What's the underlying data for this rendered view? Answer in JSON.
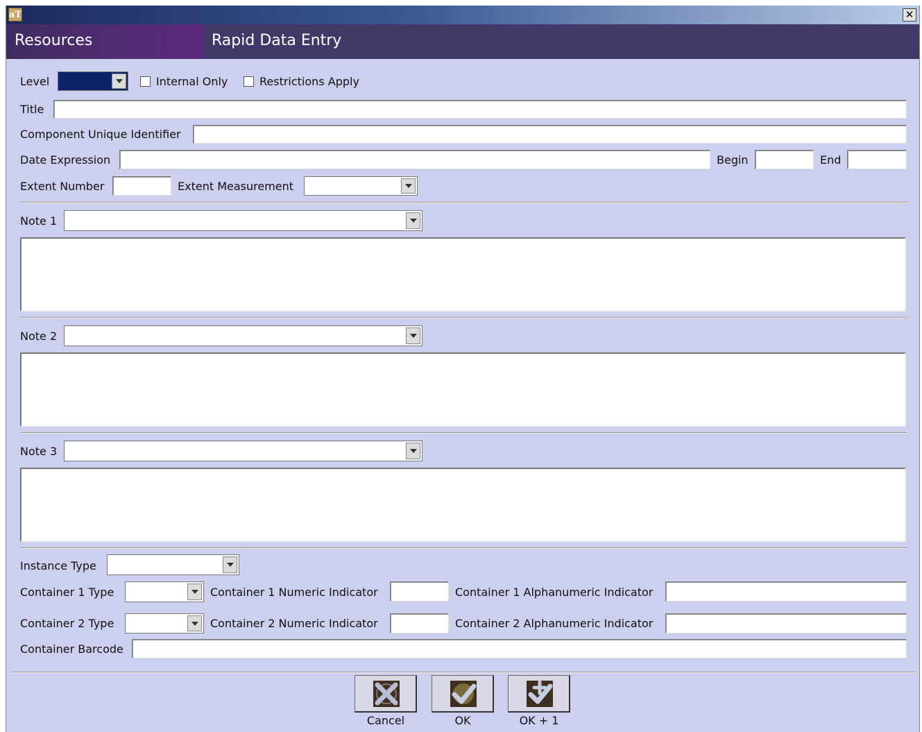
{
  "header": {
    "left_title": "Resources",
    "right_title": "Rapid Data Entry"
  },
  "window": {
    "close_glyph": "✕",
    "app_icon_text": "aT"
  },
  "top_row": {
    "level_label": "Level",
    "level_value": "",
    "internal_only_label": "Internal Only",
    "internal_only_checked": false,
    "restrictions_label": "Restrictions Apply",
    "restrictions_checked": false
  },
  "fields": {
    "title_label": "Title",
    "title_value": "",
    "cuid_label": "Component Unique Identifier",
    "cuid_value": "",
    "date_expr_label": "Date Expression",
    "date_expr_value": "",
    "begin_label": "Begin",
    "begin_value": "",
    "end_label": "End",
    "end_value": "",
    "extent_number_label": "Extent Number",
    "extent_number_value": "",
    "extent_measurement_label": "Extent Measurement",
    "extent_measurement_value": ""
  },
  "notes": [
    {
      "label": "Note 1",
      "type": "",
      "text": ""
    },
    {
      "label": "Note 2",
      "type": "",
      "text": ""
    },
    {
      "label": "Note 3",
      "type": "",
      "text": ""
    }
  ],
  "instance": {
    "type_label": "Instance Type",
    "type_value": "",
    "c1_type_label": "Container 1 Type",
    "c1_num_label": "Container 1 Numeric Indicator",
    "c1_alpha_label": "Container 1 Alphanumeric Indicator",
    "c2_type_label": "Container 2 Type",
    "c2_num_label": "Container 2 Numeric Indicator",
    "c2_alpha_label": "Container 2 Alphanumeric Indicator",
    "barcode_label": "Container Barcode"
  },
  "buttons": {
    "cancel": "Cancel",
    "ok": "OK",
    "ok_plus": "OK + 1"
  },
  "colors": {
    "background": "#cccfee",
    "header": "#413a68",
    "header_left": "#5d2a7e",
    "level_fill": "#0e2466"
  }
}
